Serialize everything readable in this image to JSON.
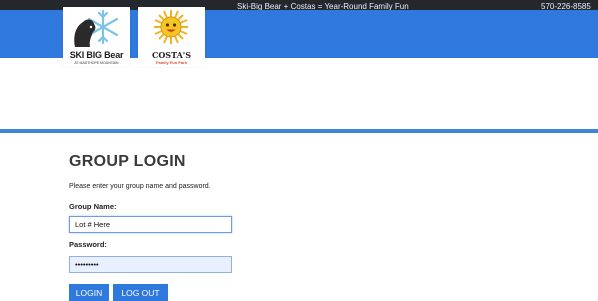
{
  "header": {
    "tagline": "Ski-Big Bear + Costas = Year-Round Family Fun",
    "phone": "570-226-8585",
    "logos": [
      {
        "name": "SKI BIG Bear",
        "subtitle": "AT MASTHOPE MOUNTAIN"
      },
      {
        "name": "COSTA'S",
        "subtitle": "Family Fun Park"
      }
    ]
  },
  "colors": {
    "brand_blue": "#2f78dd",
    "top_bar": "#24272b",
    "divider": "#3d86d8"
  },
  "login": {
    "title": "GROUP LOGIN",
    "instructions": "Please enter your group name and password.",
    "group_name_label": "Group Name:",
    "group_name_value": "Lot # Here",
    "password_label": "Password:",
    "password_value": "•••••••••",
    "login_button": "LOGIN",
    "logout_button": "LOG OUT"
  }
}
